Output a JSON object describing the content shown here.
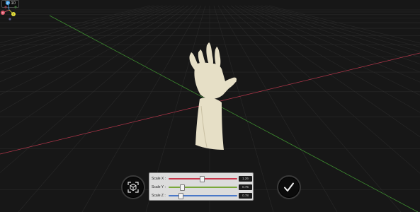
{
  "viewer": {
    "counter": "7 / 10",
    "axis_colors": {
      "x": "#b0364a",
      "y": "#3d8c2f",
      "grid": "#2a2a2a",
      "background": "#171717"
    }
  },
  "gizmo": {
    "labels": {
      "z": "Z",
      "x": "X",
      "y": "Y"
    },
    "colors": {
      "z": "#4aa3e8",
      "x": "#e0576a",
      "y": "#e8e23a",
      "neg": "#5a5a8a"
    }
  },
  "scale_panel": {
    "rows": [
      {
        "label": "Scale X :",
        "value": "1.26",
        "level": 0.47,
        "color": "#c8354a"
      },
      {
        "label": "Scale Y :",
        "value": "0.75",
        "level": 0.19,
        "color": "#7aa83a"
      },
      {
        "label": "Scale Z :",
        "value": "0.78",
        "level": 0.17,
        "color": "#4a78c8"
      }
    ]
  },
  "buttons": {
    "reset_icon": "frame-object-icon",
    "confirm_icon": "checkmark-icon"
  },
  "object": {
    "name": "hand-model",
    "color": "#e6dfc6"
  }
}
